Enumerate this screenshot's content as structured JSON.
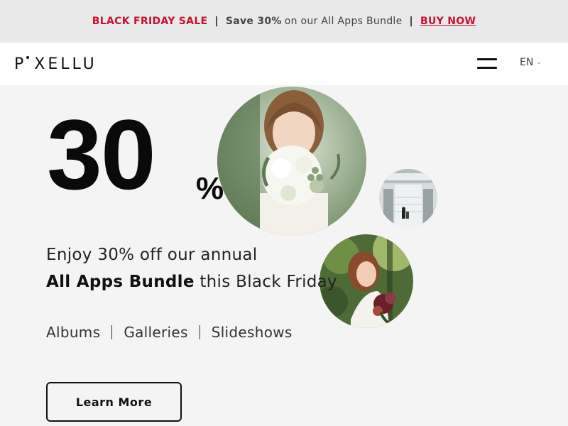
{
  "promo": {
    "sale_label": "BLACK FRIDAY SALE",
    "separator": "|",
    "save_text": "Save 30%",
    "offer_text": "on our All Apps Bundle",
    "cta_label": "BUY NOW",
    "accent_color": "#c8102e"
  },
  "nav": {
    "logo": "PIXELLU",
    "logo_display": "P XELLU",
    "menu_icon": "hamburger-icon",
    "language": "EN",
    "language_icon": "chevron-down-icon"
  },
  "hero": {
    "discount_number": "30",
    "discount_symbol": "%",
    "subtitle": "Enjoy 30% off our annual",
    "headline_bold": "All Apps Bundle",
    "headline_rest": " this Black Friday",
    "features": [
      "Albums",
      "Galleries",
      "Slideshows"
    ],
    "cta_label": "Learn More"
  }
}
